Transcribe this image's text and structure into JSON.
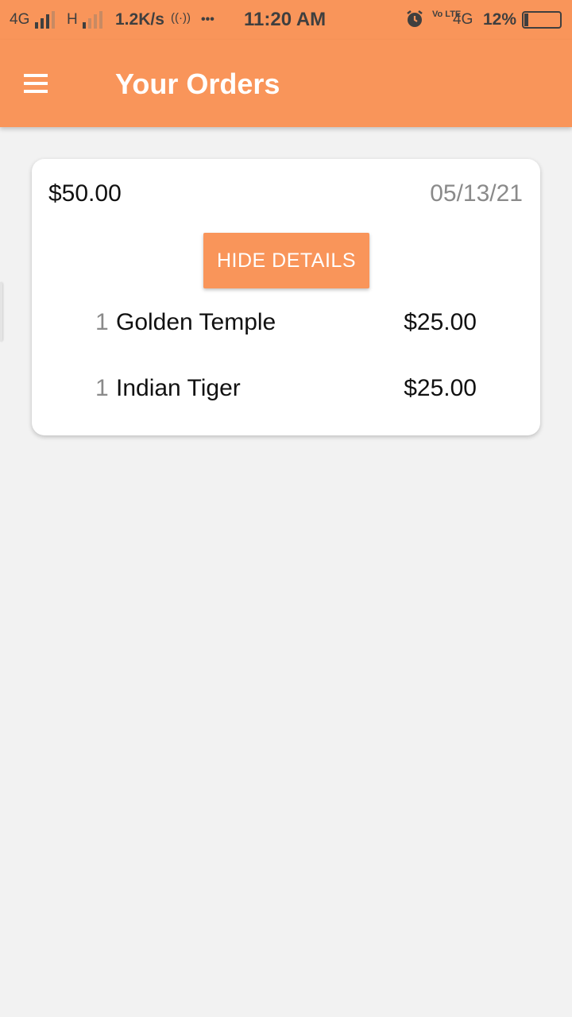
{
  "status_bar": {
    "network1": "4G",
    "network2": "H",
    "speed": "1.2K/s",
    "hotspot": "((·))",
    "more": "•••",
    "time": "11:20 AM",
    "volte": "Vo LTE",
    "network3": "4G",
    "battery_percent": "12%",
    "battery_level": 0.12
  },
  "app_bar": {
    "title": "Your Orders",
    "menu_icon": "hamburger-menu-icon"
  },
  "colors": {
    "accent": "#f9955a",
    "background": "#f2f2f2",
    "card": "#ffffff",
    "secondary_text": "#8a8a8a"
  },
  "order": {
    "total": "$50.00",
    "date": "05/13/21",
    "toggle_label": "HIDE DETAILS",
    "items": [
      {
        "qty": "1",
        "name": "Golden Temple",
        "price": "$25.00"
      },
      {
        "qty": "1",
        "name": "Indian Tiger",
        "price": "$25.00"
      }
    ]
  }
}
